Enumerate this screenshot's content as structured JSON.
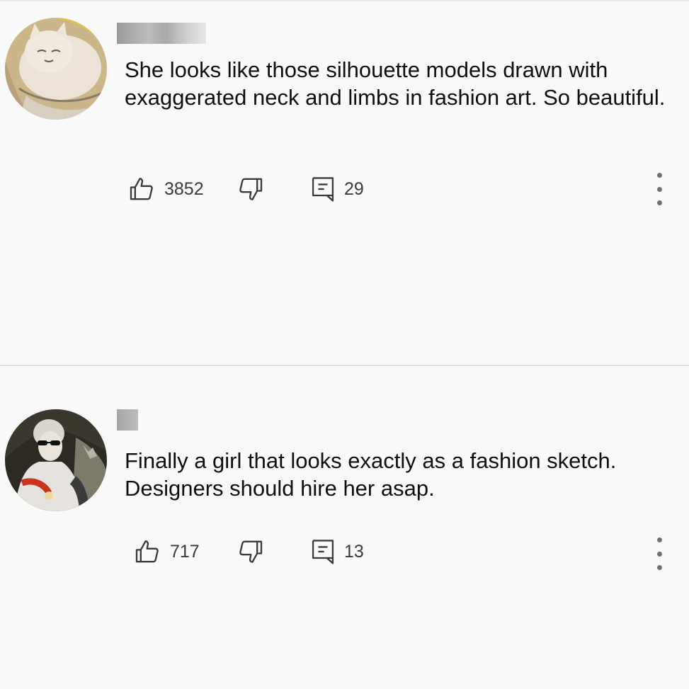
{
  "comments": [
    {
      "username": "redacted",
      "avatar_icon": "cat-painting-avatar",
      "text": "She looks like those silhouette models drawn with exaggerated neck and limbs in fashion art. So beautiful.",
      "likes": "3852",
      "replies": "29"
    },
    {
      "username": "redacted",
      "avatar_icon": "portrait-painting-avatar",
      "text": "Finally a girl that looks exactly  as a fashion sketch. Designers should hire her asap.",
      "likes": "717",
      "replies": "13"
    }
  ],
  "icons": {
    "like": "thumbs-up-icon",
    "dislike": "thumbs-down-icon",
    "reply": "comment-reply-icon",
    "more": "more-vert-icon"
  },
  "colors": {
    "background": "#f9f9f9",
    "text": "#0f0f0f",
    "icon": "#3a3a3a",
    "divider": "#dedede"
  }
}
